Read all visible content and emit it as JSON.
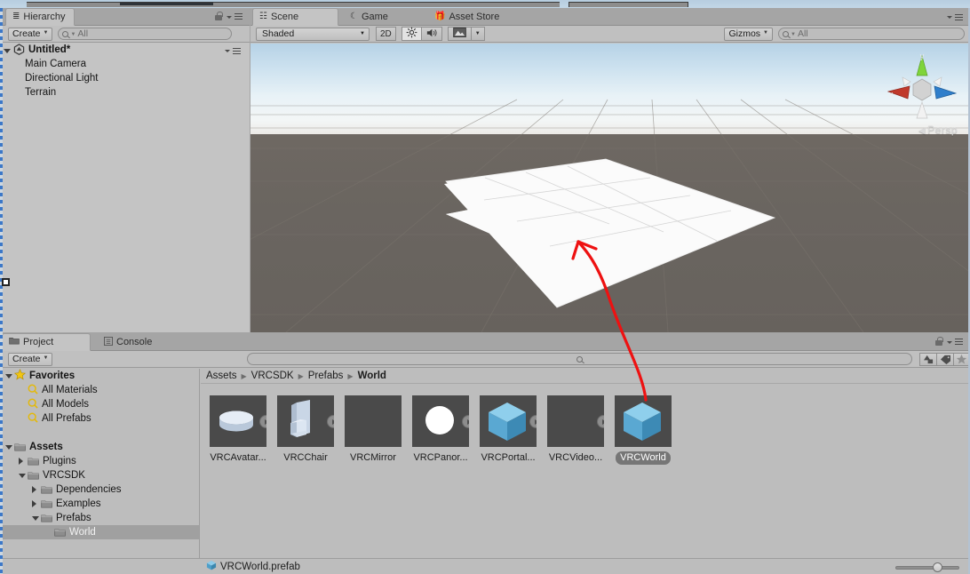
{
  "hierarchy": {
    "tab_label": "Hierarchy",
    "tab_icon": "hierarchy-icon",
    "create_label": "Create",
    "search_placeholder": "All",
    "scene_name": "Untitled*",
    "objects": [
      {
        "label": "Main Camera"
      },
      {
        "label": "Directional Light"
      },
      {
        "label": "Terrain"
      }
    ]
  },
  "scene": {
    "tabs": [
      {
        "label": "Scene",
        "icon": "grid-icon",
        "active": true
      },
      {
        "label": "Game",
        "icon": "gamepad-icon",
        "active": false
      },
      {
        "label": "Asset Store",
        "icon": "store-icon",
        "active": false
      }
    ],
    "draw_mode": "Shaded",
    "toggle_2d": "2D",
    "lighting_icon": "sun-icon",
    "audio_icon": "speaker-icon",
    "effects_icon": "image-icon",
    "gizmos_label": "Gizmos",
    "gizmos_search_placeholder": "All",
    "projection_label": "Persp",
    "gizmo_axes": {
      "x": "x",
      "y": "y",
      "z": "z"
    }
  },
  "project": {
    "tabs": [
      {
        "label": "Project",
        "icon": "folder-icon",
        "active": true
      },
      {
        "label": "Console",
        "icon": "console-icon",
        "active": false
      }
    ],
    "create_label": "Create",
    "search_placeholder": "",
    "filter_icons": [
      "shapes-filter-icon",
      "label-filter-icon",
      "star-filter-icon"
    ],
    "tree": [
      {
        "label": "Favorites",
        "depth": 0,
        "icon": "star-icon",
        "expanded": true,
        "bold": true,
        "selected": false
      },
      {
        "label": "All Materials",
        "depth": 1,
        "icon": "search-icon",
        "expanded": null,
        "bold": false,
        "selected": false
      },
      {
        "label": "All Models",
        "depth": 1,
        "icon": "search-icon",
        "expanded": null,
        "bold": false,
        "selected": false
      },
      {
        "label": "All Prefabs",
        "depth": 1,
        "icon": "search-icon",
        "expanded": null,
        "bold": false,
        "selected": false
      },
      {
        "label": "",
        "depth": 0,
        "icon": "none",
        "expanded": null,
        "bold": false,
        "selected": false
      },
      {
        "label": "Assets",
        "depth": 0,
        "icon": "folder-icon",
        "expanded": true,
        "bold": true,
        "selected": false
      },
      {
        "label": "Plugins",
        "depth": 1,
        "icon": "folder-icon",
        "expanded": false,
        "bold": false,
        "selected": false
      },
      {
        "label": "VRCSDK",
        "depth": 1,
        "icon": "folder-icon",
        "expanded": true,
        "bold": false,
        "selected": false
      },
      {
        "label": "Dependencies",
        "depth": 2,
        "icon": "folder-icon",
        "expanded": false,
        "bold": false,
        "selected": false
      },
      {
        "label": "Examples",
        "depth": 2,
        "icon": "folder-icon",
        "expanded": false,
        "bold": false,
        "selected": false
      },
      {
        "label": "Prefabs",
        "depth": 2,
        "icon": "folder-icon",
        "expanded": true,
        "bold": false,
        "selected": false
      },
      {
        "label": "World",
        "depth": 3,
        "icon": "folder-icon",
        "expanded": null,
        "bold": false,
        "selected": true
      }
    ],
    "breadcrumb": [
      "Assets",
      "VRCSDK",
      "Prefabs",
      "World"
    ],
    "assets": [
      {
        "label": "VRCAvatar...",
        "thumb": "cylinder",
        "has_prefab_arrow": true,
        "selected": false
      },
      {
        "label": "VRCChair",
        "thumb": "chair",
        "has_prefab_arrow": true,
        "selected": false
      },
      {
        "label": "VRCMirror",
        "thumb": "empty",
        "has_prefab_arrow": false,
        "selected": false
      },
      {
        "label": "VRCPanor...",
        "thumb": "sphere",
        "has_prefab_arrow": true,
        "selected": false
      },
      {
        "label": "VRCPortal...",
        "thumb": "cube",
        "has_prefab_arrow": true,
        "selected": false
      },
      {
        "label": "VRCVideo...",
        "thumb": "empty",
        "has_prefab_arrow": true,
        "selected": false
      },
      {
        "label": "VRCWorld",
        "thumb": "cube",
        "has_prefab_arrow": false,
        "selected": true
      }
    ],
    "status_file": "VRCWorld.prefab",
    "status_file_icon": "prefab-cube-icon",
    "zoom_slider_value": 58
  },
  "annotation": {
    "arrow_color": "#ee1111",
    "description": "red arrow from VRCWorld prefab to terrain plane"
  },
  "colors": {
    "panel_bg": "#bdbdbd",
    "tab_bar": "#a5a5a5",
    "scene_ground": "#6b6660",
    "prefab_blue": "#5aaedb",
    "selection": "#a0a0a0"
  }
}
